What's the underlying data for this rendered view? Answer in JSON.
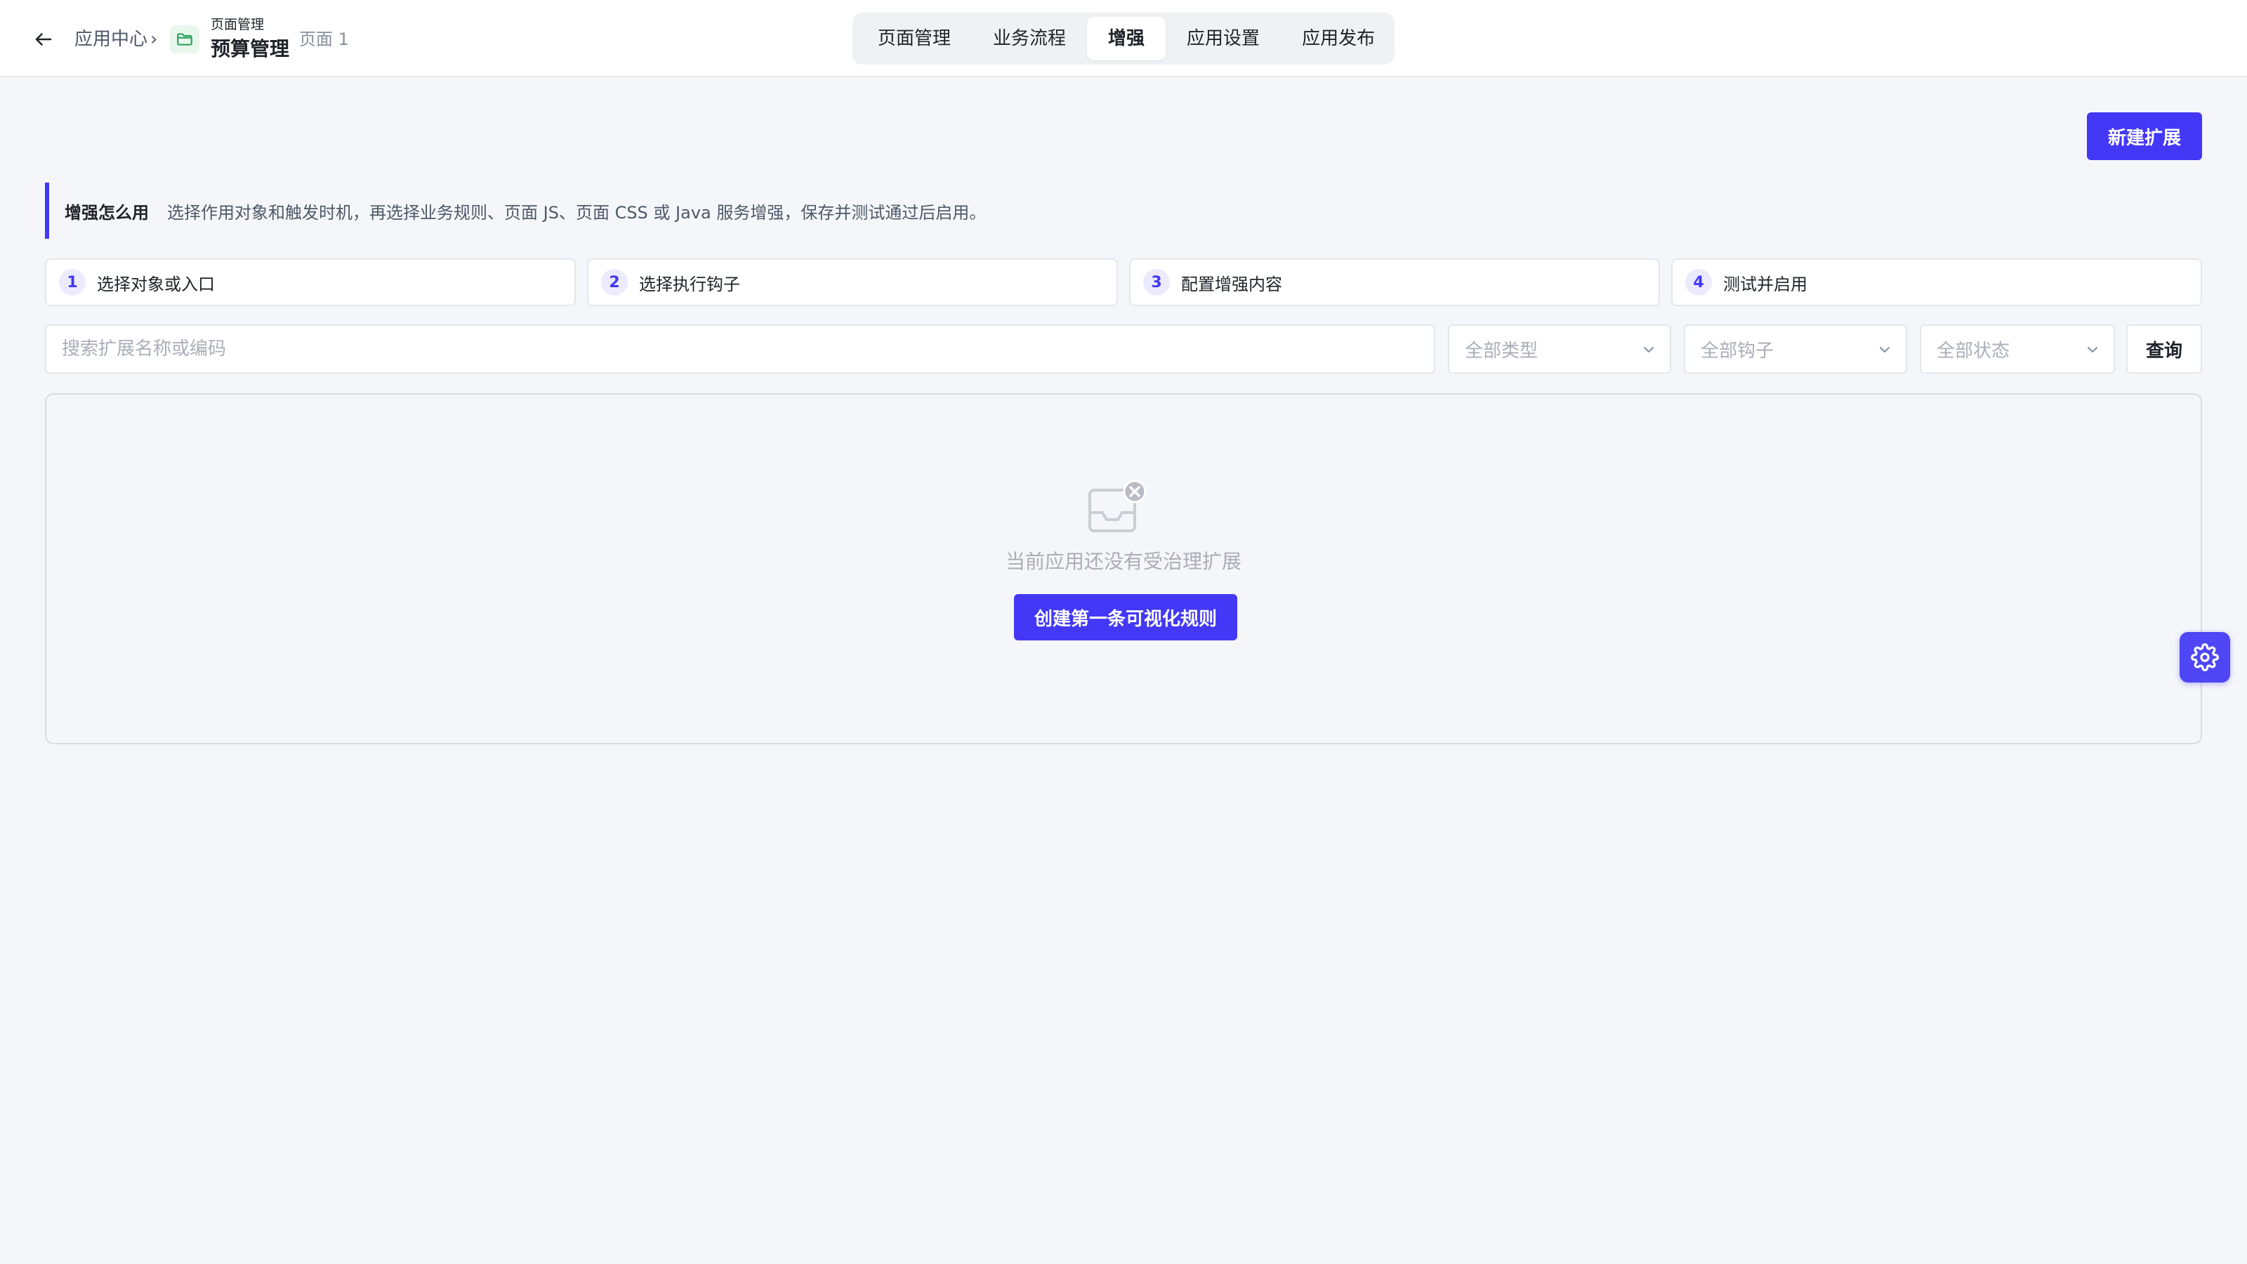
{
  "header": {
    "breadcrumb_root": "应用中心",
    "breadcrumb_separator": "›",
    "module_small": "页面管理",
    "module_title": "预算管理",
    "page_label": "页面 1",
    "tabs": [
      {
        "label": "页面管理",
        "active": false
      },
      {
        "label": "业务流程",
        "active": false
      },
      {
        "label": "增强",
        "active": true
      },
      {
        "label": "应用设置",
        "active": false
      },
      {
        "label": "应用发布",
        "active": false
      }
    ],
    "icons": {
      "back": "arrow-left-icon",
      "folder": "folder-icon"
    }
  },
  "actions": {
    "new_extension": "新建扩展"
  },
  "howto": {
    "title": "增强怎么用",
    "text": "选择作用对象和触发时机，再选择业务规则、页面 JS、页面 CSS 或 Java 服务增强，保存并测试通过后启用。"
  },
  "steps": [
    {
      "num": "1",
      "label": "选择对象或入口"
    },
    {
      "num": "2",
      "label": "选择执行钩子"
    },
    {
      "num": "3",
      "label": "配置增强内容"
    },
    {
      "num": "4",
      "label": "测试并启用"
    }
  ],
  "filters": {
    "search_placeholder": "搜索扩展名称或编码",
    "type_select": "全部类型",
    "hook_select": "全部钩子",
    "status_select": "全部状态",
    "query_label": "查询"
  },
  "empty": {
    "icon": "empty-inbox-icon",
    "text": "当前应用还没有受治理扩展",
    "create_label": "创建第一条可视化规则"
  },
  "floating": {
    "icon": "gear-icon"
  },
  "colors": {
    "accent": "#4338f5",
    "background": "#f5f6f9",
    "step_badge_bg": "#ecebfe",
    "folder_bg": "#e8f7ee",
    "folder_stroke": "#2ea35a"
  }
}
